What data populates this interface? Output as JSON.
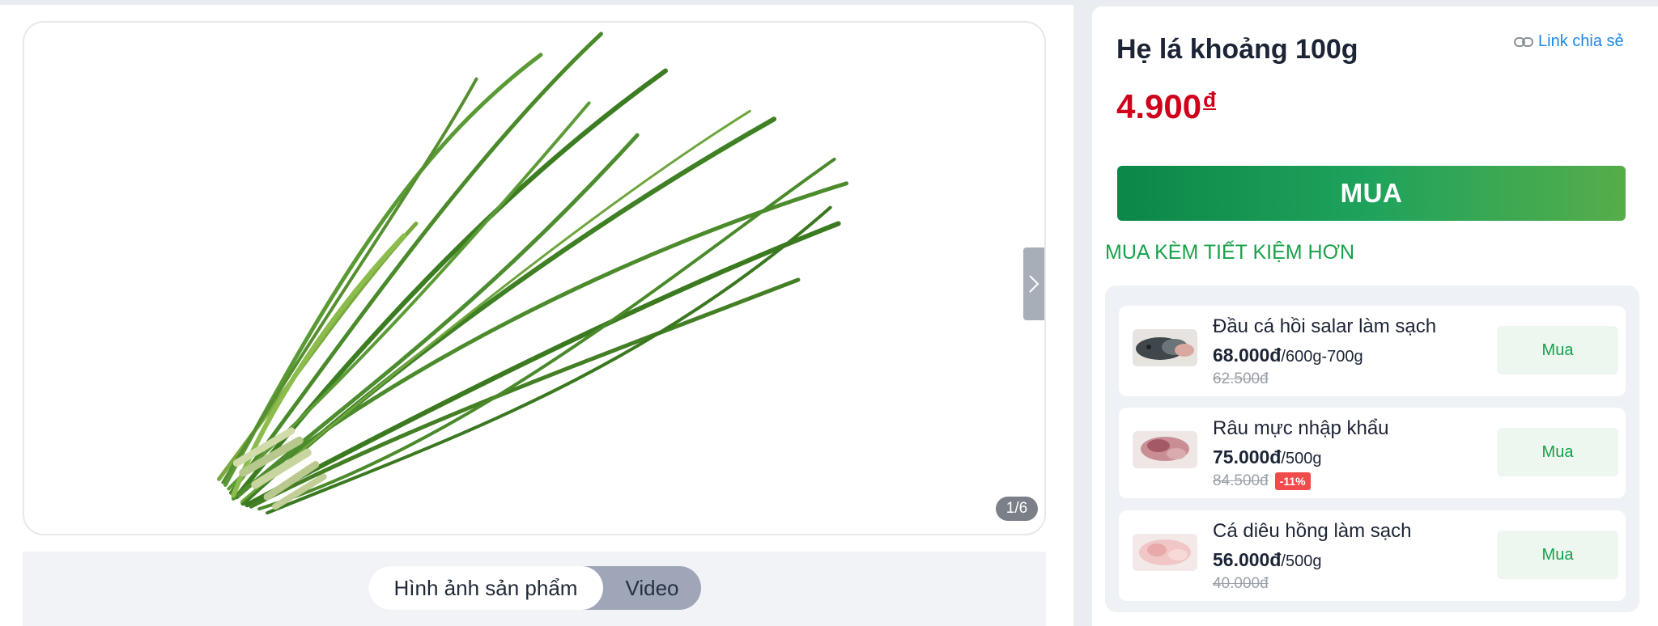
{
  "gallery": {
    "counter": "1/6",
    "tabs": [
      {
        "label": "Hình ảnh sản phẩm",
        "active": true
      },
      {
        "label": "Video",
        "active": false
      }
    ]
  },
  "product": {
    "title": "Hẹ lá khoảng 100g",
    "price": "4.900",
    "currency": "đ",
    "share_label": "Link chia sẻ",
    "buy_label": "MUA"
  },
  "bundle": {
    "heading": "MUA KÈM TIẾT KIỆM HƠN",
    "items": [
      {
        "name": "Đầu cá hồi salar làm sạch",
        "price": "68.000đ",
        "unit": "/600g-700g",
        "old_price": "62.500đ",
        "discount": "",
        "buy_label": "Mua"
      },
      {
        "name": "Râu mực nhập khẩu",
        "price": "75.000đ",
        "unit": "/500g",
        "old_price": "84.500đ",
        "discount": "-11%",
        "buy_label": "Mua"
      },
      {
        "name": "Cá diêu hồng làm sạch",
        "price": "56.000đ",
        "unit": "/500g",
        "old_price": "40.000đ",
        "discount": "",
        "buy_label": "Mua"
      }
    ]
  },
  "colors": {
    "price_red": "#d0021b",
    "brand_green": "#0b8747",
    "bundle_heading_green": "#17a24a",
    "link_blue": "#1e88e5"
  }
}
